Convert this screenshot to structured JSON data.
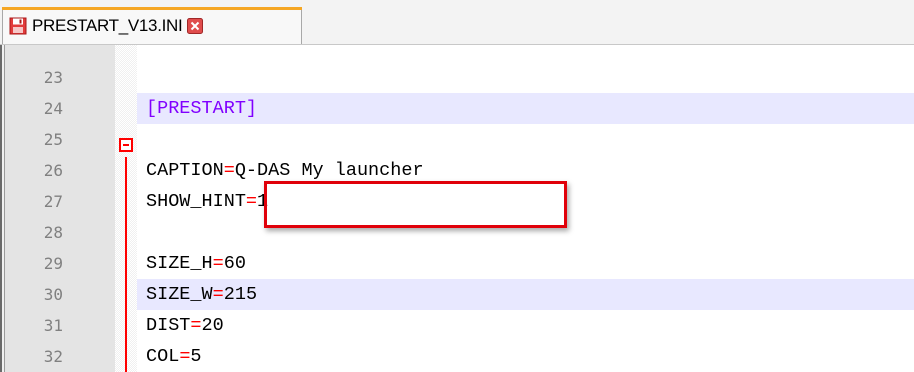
{
  "tab": {
    "filename": "PRESTART_V13.INI",
    "save_icon": "floppy-disk-red-icon",
    "close_icon": "close-x-icon"
  },
  "editor": {
    "lines": [
      {
        "number": "23",
        "key": "",
        "eq": "",
        "value": "",
        "section": "",
        "highlighted": false
      },
      {
        "number": "24",
        "key": "",
        "eq": "",
        "value": "",
        "section": "[PRESTART]",
        "highlighted": true
      },
      {
        "number": "25",
        "key": "",
        "eq": "",
        "value": "",
        "section": "",
        "highlighted": false
      },
      {
        "number": "26",
        "key": "CAPTION",
        "eq": "=",
        "value": "Q-DAS My launcher",
        "section": "",
        "highlighted": false
      },
      {
        "number": "27",
        "key": "SHOW_HINT",
        "eq": "=",
        "value": "1",
        "section": "",
        "highlighted": false
      },
      {
        "number": "28",
        "key": "",
        "eq": "",
        "value": "",
        "section": "",
        "highlighted": false
      },
      {
        "number": "29",
        "key": "SIZE_H",
        "eq": "=",
        "value": "60",
        "section": "",
        "highlighted": false
      },
      {
        "number": "30",
        "key": "SIZE_W",
        "eq": "=",
        "value": "215",
        "section": "",
        "highlighted": true
      },
      {
        "number": "31",
        "key": "DIST",
        "eq": "=",
        "value": "20",
        "section": "",
        "highlighted": false
      },
      {
        "number": "32",
        "key": "COL",
        "eq": "=",
        "value": "5",
        "section": "",
        "highlighted": false
      }
    ],
    "fold_icon": "fold-collapse-minus-icon",
    "annotation_color": "#e0000a",
    "section_color": "#8000ff",
    "operator_color": "#ff0000",
    "current_line_color": "#e8e8ff"
  }
}
